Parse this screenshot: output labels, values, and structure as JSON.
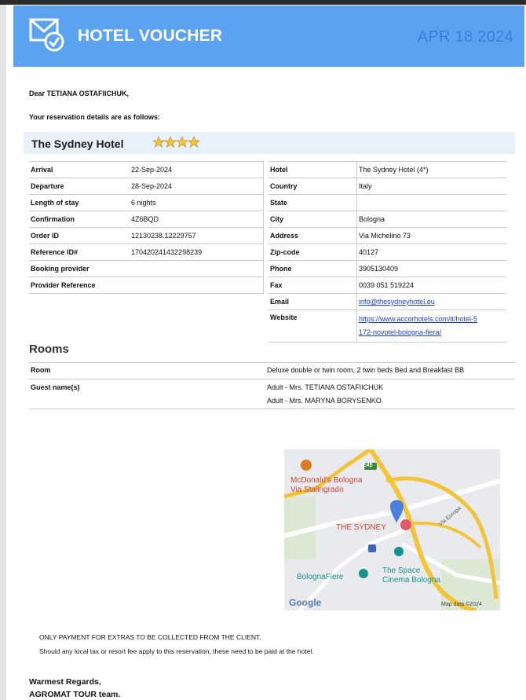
{
  "header": {
    "title": "HOTEL VOUCHER",
    "date": "APR 18 2024"
  },
  "greeting": "Dear TETIANA OSTAFIICHUK,",
  "intro": "Your reservation details are as follows:",
  "hotel": {
    "name": "The Sydney Hotel",
    "stars": 4
  },
  "details_left": [
    {
      "label": "Arrival",
      "value": "22-Sep-2024"
    },
    {
      "label": "Departure",
      "value": "28-Sep-2024"
    },
    {
      "label": "Length of stay",
      "value": "6 nights"
    },
    {
      "label": "Confirmation",
      "value": "4Z6BQD"
    },
    {
      "label": "Order ID",
      "value": "12130238.12229757"
    },
    {
      "label": "Reference ID#",
      "value": "170420241432298239"
    },
    {
      "label": "Booking provider",
      "value": ""
    },
    {
      "label": "Provider Reference",
      "value": ""
    }
  ],
  "details_right": [
    {
      "label": "Hotel",
      "value": "The Sydney Hotel (4*)"
    },
    {
      "label": "Country",
      "value": "Italy"
    },
    {
      "label": "State",
      "value": ""
    },
    {
      "label": "City",
      "value": "Bologna"
    },
    {
      "label": "Address",
      "value": "Via Michelino 73"
    },
    {
      "label": "Zip-code",
      "value": "40127"
    },
    {
      "label": "Phone",
      "value": "3905130409"
    },
    {
      "label": "Fax",
      "value": "0039 051 519224"
    },
    {
      "label": "Email",
      "value": "info@thesydneyhotel.eu"
    },
    {
      "label": "Website",
      "value_line1": "https://www.accorhotels.com/it/hotel-5",
      "value_line2": "172-novotel-bologna-fiera/"
    }
  ],
  "rooms": {
    "title": "Rooms",
    "room_label": "Room",
    "room_value": "Deluxe double or twin room, 2 twin beds Bed and Breakfast BB",
    "guests_label": "Guest name(s)",
    "guests": [
      "Adult - Mrs. TETIANA OSTAFIICHUK",
      "Adult - Mrs. MARYNA BORYSENKO"
    ]
  },
  "map": {
    "labels": {
      "road_badge": "E45",
      "mcdonalds_line1": "McDonald's Bologna",
      "mcdonalds_line2": "Via Stalingrado",
      "hotel": "THE SYDNEY",
      "via_europa": "Via Europa",
      "fiere": "BolognaFiere",
      "space_line1": "The Space",
      "space_line2": "Cinema Bologna",
      "google": "Google",
      "attribution": "Map data ©2024"
    },
    "colors": {
      "road": "#f3c33a",
      "background": "#e8eaed",
      "label_red": "#c8463a",
      "label_teal": "#15938f"
    }
  },
  "notes": {
    "line1": "ONLY PAYMENT FOR EXTRAS TO BE COLLECTED FROM THE CLIENT.",
    "line2": "Should any local tax or resort fee apply to this reservation, these need to be paid at the hotel."
  },
  "closing": {
    "line1": "Warmest Regards,",
    "line2": "AGROMAT TOUR team."
  }
}
